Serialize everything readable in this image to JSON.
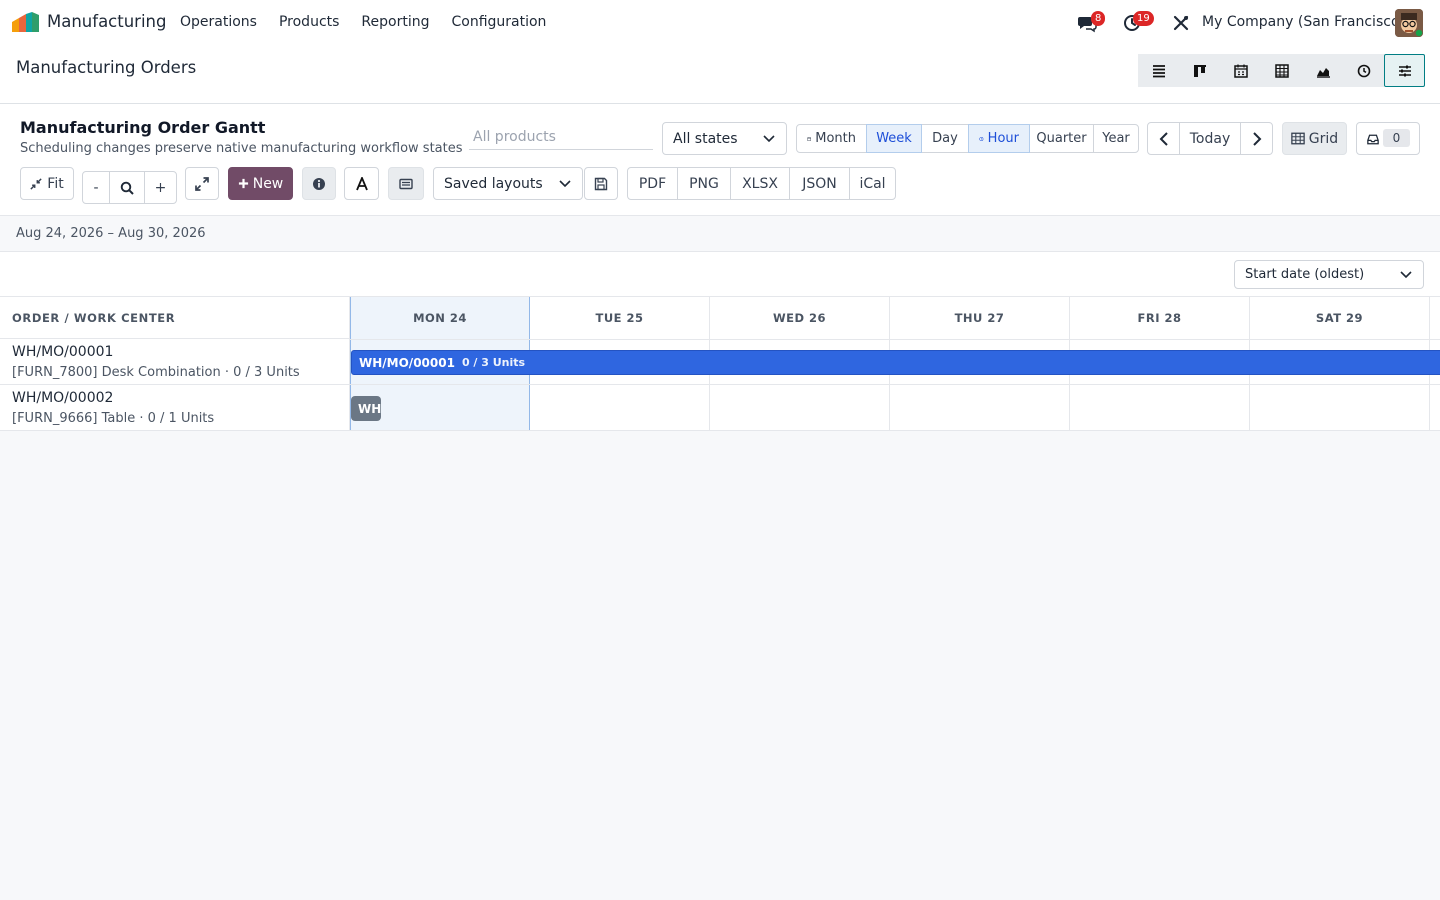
{
  "navbar": {
    "app_name": "Manufacturing",
    "menu": [
      "Operations",
      "Products",
      "Reporting",
      "Configuration"
    ],
    "messages_count": "8",
    "activities_count": "19",
    "company": "My Company (San Francisco)"
  },
  "control_panel": {
    "title": "Manufacturing Orders"
  },
  "gantt": {
    "title": "Manufacturing Order Gantt",
    "subtitle": "Scheduling changes preserve native manufacturing workflow states",
    "product_placeholder": "All products",
    "state_select": "All states",
    "scales": [
      "Month",
      "Week",
      "Day",
      "Hour",
      "Quarter",
      "Year"
    ],
    "active_scale": "Week",
    "today_label": "Today",
    "grid_label": "Grid",
    "inbox_count": "0",
    "fit_label": "Fit",
    "zoom_out_label": "-",
    "zoom_in_label": "+",
    "new_label": "New",
    "saved_layouts": "Saved layouts",
    "exports": [
      "PDF",
      "PNG",
      "XLSX",
      "JSON",
      "iCal"
    ],
    "date_range": "Aug 24, 2026 – Aug 30, 2026",
    "sort_select": "Start date (oldest)",
    "left_header": "ORDER / WORK CENTER",
    "days": [
      "MON 24",
      "TUE 25",
      "WED 26",
      "THU 27",
      "FRI 28",
      "SAT 29"
    ],
    "rows": [
      {
        "name": "WH/MO/00001",
        "detail": "[FURN_7800] Desk Combination · 0 / 3 Units",
        "bar_label": "WH/MO/00001",
        "bar_units": "0 / 3 Units"
      },
      {
        "name": "WH/MO/00002",
        "detail": "[FURN_9666] Table · 0 / 1 Units",
        "bar_label": "WH"
      }
    ]
  },
  "colors": {
    "brand": "#714b67",
    "accent": "#017e84",
    "bar_blue": "#2f66e0",
    "bar_gray": "#6b7785",
    "badge_red": "#dc2626"
  }
}
